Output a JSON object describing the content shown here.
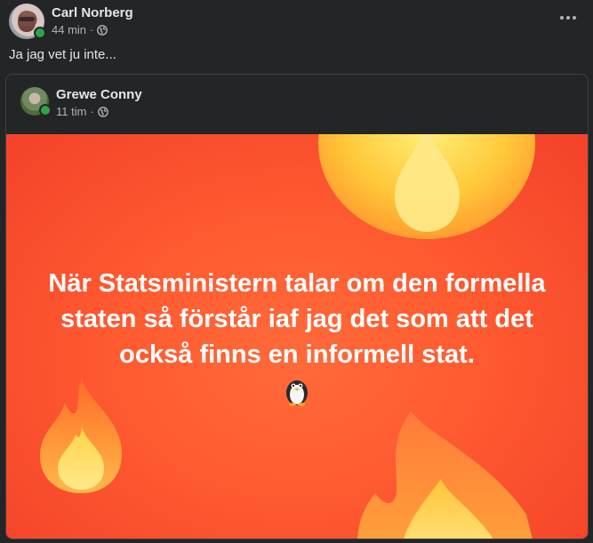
{
  "post": {
    "author": "Carl Norberg",
    "time": "44 min",
    "separator": "·",
    "text": "Ja jag vet ju inte..."
  },
  "shared_post": {
    "author": "Grewe Conny",
    "time": "11 tim",
    "separator": "·",
    "quote": "När Statsministern talar om den formella staten så förstår iaf jag det som att det också finns en informell stat.",
    "banner_colors": {
      "background": "#ff5a30",
      "flame_outer": "#ff9a3c",
      "flame_inner": "#ffd84a"
    }
  },
  "icons": {
    "privacy": "globe-icon",
    "menu": "more-options-icon",
    "emoji": "penguin-emoji"
  },
  "colors": {
    "background": "#242526",
    "online": "#31a24c",
    "text_secondary": "#b0b3b8"
  }
}
